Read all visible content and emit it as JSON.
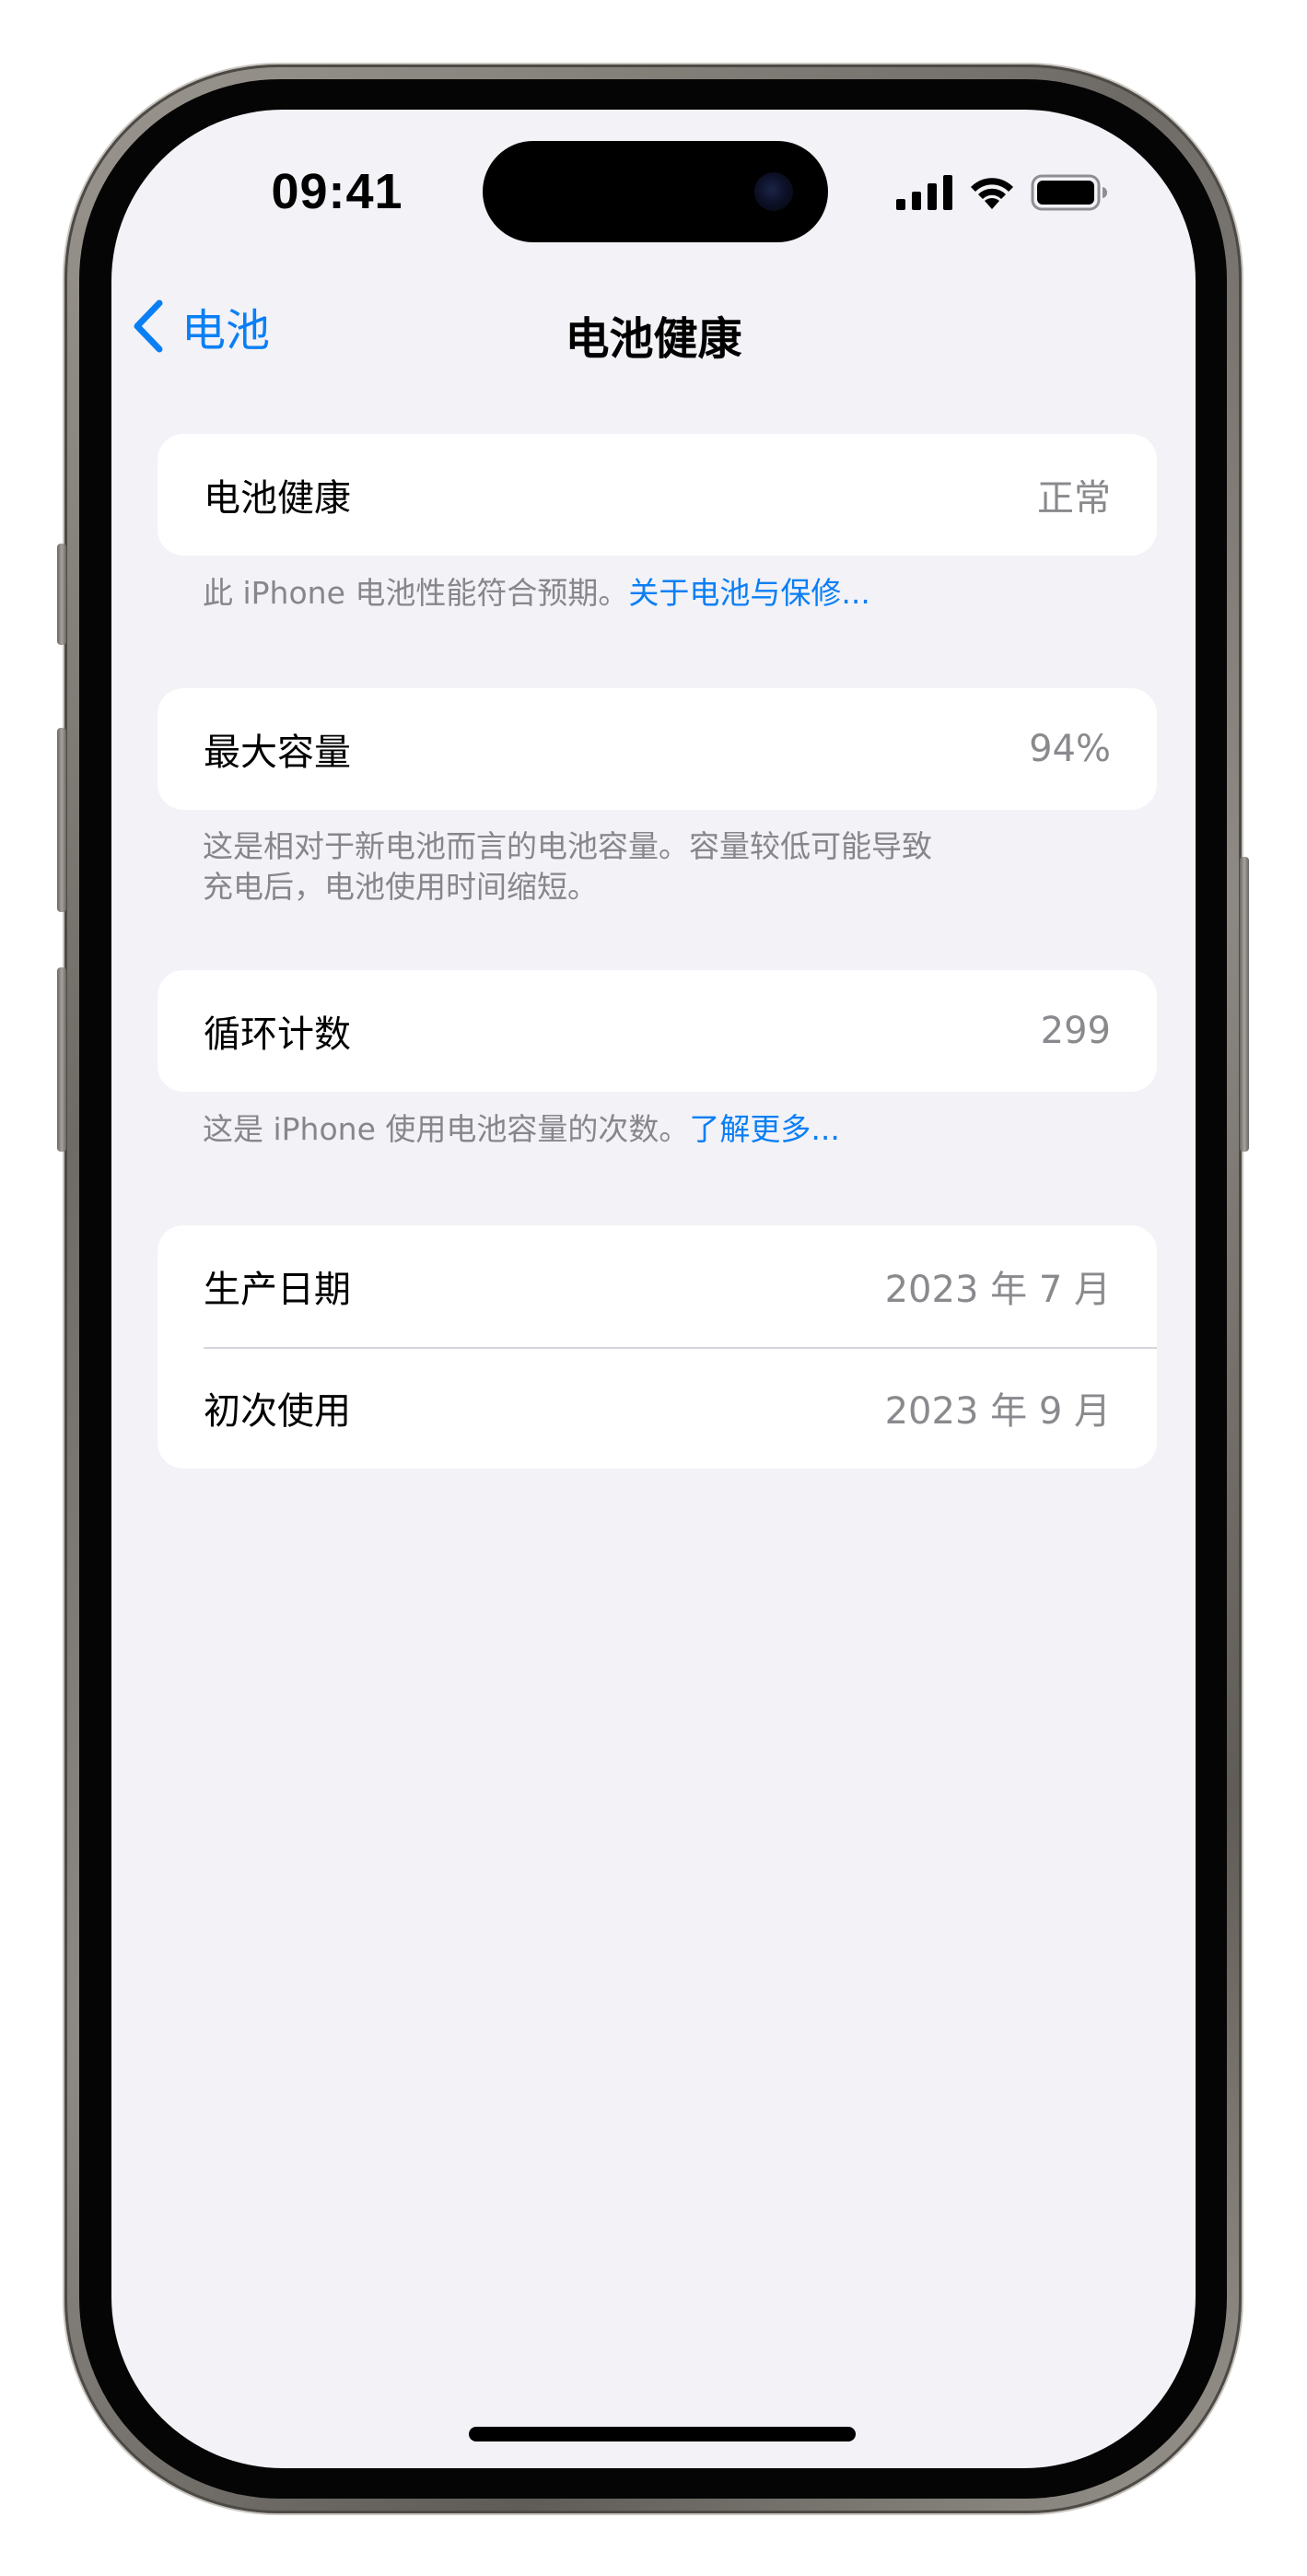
{
  "status_bar": {
    "time": "09:41",
    "icons": [
      "cellular-signal-icon",
      "wifi-icon",
      "battery-icon"
    ]
  },
  "nav": {
    "back_label": "电池",
    "title": "电池健康"
  },
  "sections": {
    "health": {
      "label": "电池健康",
      "value": "正常",
      "footnote_text": "此 iPhone 电池性能符合预期。",
      "footnote_link": "关于电池与保修..."
    },
    "capacity": {
      "label": "最大容量",
      "value": "94%",
      "footnote_line1": "这是相对于新电池而言的电池容量。容量较低可能导致",
      "footnote_line2": "充电后，电池使用时间缩短。"
    },
    "cycles": {
      "label": "循环计数",
      "value": "299",
      "footnote_text": "这是 iPhone 使用电池容量的次数。",
      "footnote_link": "了解更多..."
    },
    "dates": {
      "manufacture_label": "生产日期",
      "manufacture_value": "2023 年 7 月",
      "first_use_label": "初次使用",
      "first_use_value": "2023 年 9 月"
    }
  },
  "colors": {
    "accent": "#0a7ff5",
    "background": "#f2f2f7",
    "secondary_text": "#8a8a8e",
    "card": "#ffffff"
  }
}
